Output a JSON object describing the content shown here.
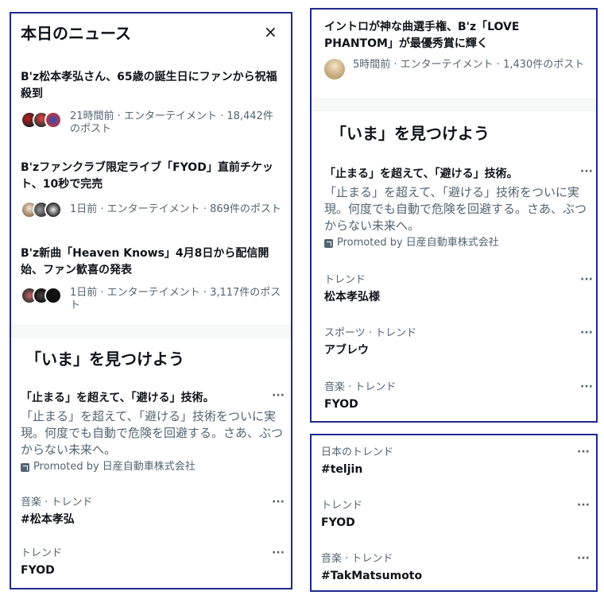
{
  "today_news": {
    "title": "本日のニュース",
    "close_label": "×",
    "items": [
      {
        "title": "B'z松本孝弘さん、65歳の誕生日にファンから祝福殺到",
        "meta": "21時間前 · エンターテイメント · 18,442件のポスト"
      },
      {
        "title": "B'zファンクラブ限定ライブ「FYOD」直前チケット、10秒で完売",
        "meta": "1日前 · エンターテイメント · 869件のポスト"
      },
      {
        "title": "B'z新曲「Heaven Knows」4月8日から配信開始、ファン歓喜の発表",
        "meta": "1日前 · エンターテイメント · 3,117件のポスト"
      }
    ]
  },
  "left_explore": {
    "title": "「いま」を見つけよう",
    "ad": {
      "title": "「止まる」を超えて、「避ける」技術。",
      "body": "「止まる」を超えて、「避ける」技術をついに実現。何度でも自動で危険を回避する。さあ、ぶつからない未来へ。",
      "promoted": "Promoted by 日産自動車株式会社"
    },
    "trends": [
      {
        "category": "音楽 · トレンド",
        "name": "#松本孝弘"
      },
      {
        "category": "トレンド",
        "name": "FYOD"
      }
    ]
  },
  "right_top": {
    "news": {
      "title": "イントロが神な曲選手権、B'z「LOVE PHANTOM」が最優秀賞に輝く",
      "meta": "5時間前 · エンターテイメント · 1,430件のポスト"
    },
    "explore_title": "「いま」を見つけよう",
    "ad": {
      "title": "「止まる」を超えて、「避ける」技術。",
      "body": "「止まる」を超えて、「避ける」技術をついに実現。何度でも自動で危険を回避する。さあ、ぶつからない未来へ。",
      "promoted": "Promoted by 日産自動車株式会社"
    },
    "trends": [
      {
        "category": "トレンド",
        "name": "松本孝弘様"
      },
      {
        "category": "スポーツ · トレンド",
        "name": "アブレウ"
      },
      {
        "category": "音楽 · トレンド",
        "name": "FYOD"
      }
    ]
  },
  "right_bottom": {
    "trends": [
      {
        "category": "日本のトレンド",
        "name": "#teljin"
      },
      {
        "category": "トレンド",
        "name": "FYOD"
      },
      {
        "category": "音楽 · トレンド",
        "name": "#TakMatsumoto"
      }
    ]
  },
  "more_label": "···",
  "icons": {
    "close": "close-icon",
    "more": "more-icon",
    "promoted": "promoted-icon",
    "avatar": "avatar"
  },
  "colors": {
    "panel_border": "#1e2a8c",
    "text_primary": "#0f1419",
    "text_secondary": "#536471"
  }
}
